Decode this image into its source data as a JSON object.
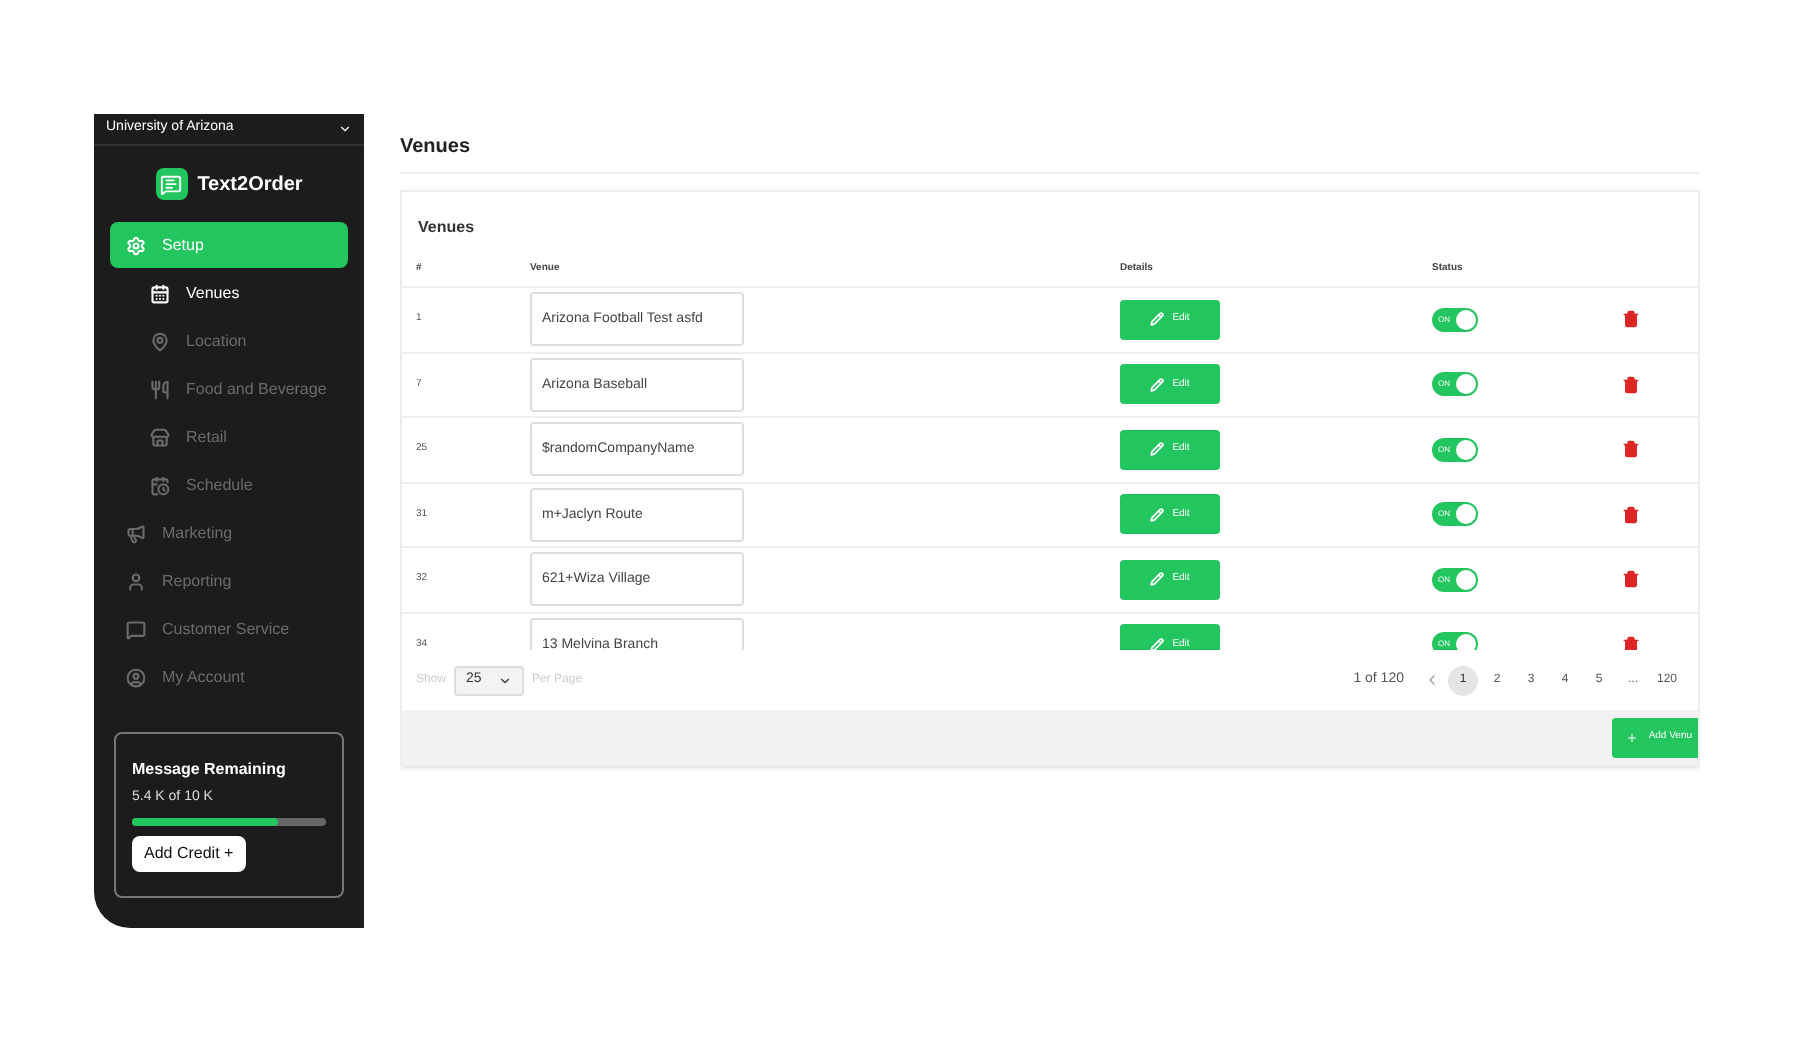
{
  "org_selector": {
    "label": "University of Arizona"
  },
  "logo": {
    "text": "Text2Order"
  },
  "sidebar": {
    "items": [
      {
        "label": "Setup",
        "kind": "setup",
        "selected": true,
        "children": [
          {
            "label": "Venues",
            "kind": "venues",
            "selected": true
          },
          {
            "label": "Location",
            "kind": "location",
            "selected": false
          },
          {
            "label": "Food and Beverage",
            "kind": "food",
            "selected": false
          },
          {
            "label": "Retail",
            "kind": "retail",
            "selected": false
          },
          {
            "label": "Schedule",
            "kind": "schedule",
            "selected": false
          }
        ]
      },
      {
        "label": "Marketing",
        "kind": "marketing",
        "selected": false
      },
      {
        "label": "Reporting",
        "kind": "reporting",
        "selected": false
      },
      {
        "label": "Customer Service",
        "kind": "service",
        "selected": false
      },
      {
        "label": "My Account",
        "kind": "account",
        "selected": false
      }
    ]
  },
  "credits": {
    "title": "Message Remaining",
    "reading": "5.4 K of 10 K",
    "level": 0.75,
    "button": "Add Credit +"
  },
  "page_title": "Venues",
  "card": {
    "title": "Venues",
    "table": {
      "columns": [
        "#",
        "Venue",
        "Details",
        "Status"
      ],
      "rows": [
        {
          "id": "1",
          "venue": "Arizona Football Test asfd",
          "action": "Edit",
          "status": "ON",
          "on": true
        },
        {
          "id": "7",
          "venue": "Arizona Baseball",
          "action": "Edit",
          "status": "ON",
          "on": true
        },
        {
          "id": "25",
          "venue": "$randomCompanyName",
          "action": "Edit",
          "status": "ON",
          "on": true
        },
        {
          "id": "31",
          "venue": "m+Jaclyn Route",
          "action": "Edit",
          "status": "ON",
          "on": true
        },
        {
          "id": "32",
          "venue": "621+Wiza Village",
          "action": "Edit",
          "status": "ON",
          "on": true
        },
        {
          "id": "34",
          "venue": "13 Melvina Branch",
          "action": "Edit",
          "status": "ON",
          "on": true
        }
      ]
    },
    "footer": {
      "show": "Show",
      "per_page_value": "25",
      "per_page": "Per Page",
      "range": "1 of 120",
      "pages": [
        {
          "label": "1",
          "selected": true
        },
        {
          "label": "2",
          "selected": false
        },
        {
          "label": "3",
          "selected": false
        },
        {
          "label": "4",
          "selected": false
        },
        {
          "label": "5",
          "selected": false
        },
        {
          "label": "...",
          "selected": false
        },
        {
          "label": "120",
          "selected": false
        }
      ]
    },
    "add_button": "Add Venu"
  }
}
